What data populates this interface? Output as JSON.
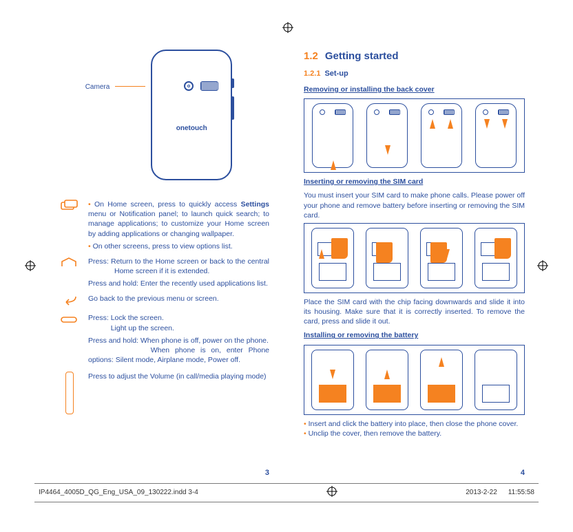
{
  "left": {
    "camera_label": "Camera",
    "phone_logo": "onetouch",
    "keys": {
      "menu": {
        "b1": "On Home screen, press to quickly access ",
        "b1_bold": "Settings",
        "b1_rest": " menu or Notification panel; to launch quick search; to manage applications;  to customize your Home screen by adding applications or changing wallpaper.",
        "b2": "On other screens, press to view options list."
      },
      "home": {
        "press": "Press: Return to the Home screen or back to the central Home screen if it is extended.",
        "hold": "Press and hold: Enter the recently used applications list."
      },
      "back": "Go back to the previous menu or screen.",
      "power": {
        "press_label": "Press:",
        "press_l1": "Lock the screen.",
        "press_l2": "Light up the screen.",
        "hold_label": "Press and hold:",
        "hold_l1": "When phone is off, power on the phone.",
        "hold_l2": "When phone is on, enter Phone options: Silent mode, Airplane mode, Power off."
      },
      "volume": "Press to adjust the Volume (in call/media playing mode)"
    },
    "page_num": "3"
  },
  "right": {
    "sec_num": "1.2",
    "sec_title": "Getting started",
    "sub_num": "1.2.1",
    "sub_title": "Set-up",
    "t1": "Removing or installing the back cover",
    "t2": "Inserting or removing the SIM card",
    "t2_para": "You must insert your SIM card to make phone calls. Please power off your phone and remove battery before inserting or removing the SIM card.",
    "t2_para2": "Place the SIM card with the chip facing downwards and slide it into its housing. Make sure that it is correctly inserted. To remove the card, press and slide it out.",
    "t3": "Installing or removing the battery",
    "t3_b1": "Insert and click the battery into place, then close the phone cover.",
    "t3_b2": "Unclip the cover, then remove the battery.",
    "page_num": "4"
  },
  "footer": {
    "file": "IP4464_4005D_QG_Eng_USA_09_130222.indd   3-4",
    "date": "2013-2-22",
    "time": "11:55:58"
  }
}
